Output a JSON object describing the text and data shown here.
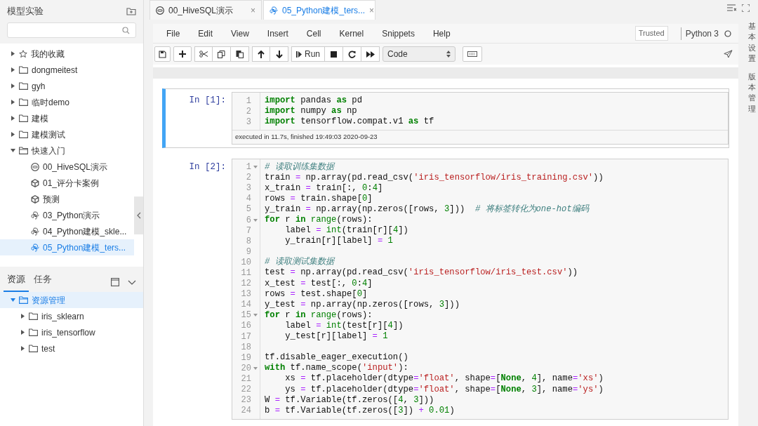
{
  "sidebar": {
    "title": "模型实验",
    "items": [
      {
        "label": "我的收藏",
        "kind": "star",
        "expanded": false,
        "selected": false
      },
      {
        "label": "dongmeitest",
        "kind": "folder",
        "expanded": false,
        "selected": false
      },
      {
        "label": "gyh",
        "kind": "folder",
        "expanded": false,
        "selected": false
      },
      {
        "label": "临时demo",
        "kind": "folder",
        "expanded": false,
        "selected": false
      },
      {
        "label": "建模",
        "kind": "folder",
        "expanded": false,
        "selected": false
      },
      {
        "label": "建模测试",
        "kind": "folder",
        "expanded": false,
        "selected": false
      },
      {
        "label": "快速入门",
        "kind": "folder",
        "expanded": true,
        "selected": false,
        "children": [
          {
            "label": "00_HiveSQL演示",
            "kind": "sql",
            "selected": false
          },
          {
            "label": "01_评分卡案例",
            "kind": "cube",
            "selected": false
          },
          {
            "label": "预测",
            "kind": "cube",
            "selected": false
          },
          {
            "label": "03_Python演示",
            "kind": "python",
            "selected": false
          },
          {
            "label": "04_Python建模_skle...",
            "kind": "python",
            "selected": false
          },
          {
            "label": "05_Python建模_ters...",
            "kind": "python",
            "selected": true
          }
        ]
      }
    ],
    "panel_tabs": [
      {
        "label": "资源",
        "selected": true
      },
      {
        "label": "任务",
        "selected": false
      }
    ],
    "resources": [
      {
        "label": "资源管理",
        "kind": "folder",
        "expanded": true,
        "selected": true,
        "children": [
          {
            "label": "iris_sklearn",
            "kind": "folder",
            "expanded": false,
            "selected": false
          },
          {
            "label": "iris_tensorflow",
            "kind": "folder",
            "expanded": false,
            "selected": false
          },
          {
            "label": "test",
            "kind": "folder",
            "expanded": false,
            "selected": false
          }
        ]
      }
    ]
  },
  "tabs": [
    {
      "label": "00_HiveSQL演示",
      "kind": "sql",
      "selected": false,
      "close": "×"
    },
    {
      "label": "05_Python建模_ters...",
      "kind": "python",
      "selected": true,
      "close": "×"
    }
  ],
  "menu": [
    "File",
    "Edit",
    "View",
    "Insert",
    "Cell",
    "Kernel",
    "Snippets",
    "Help"
  ],
  "trusted": "Trusted",
  "kernel": "Python 3",
  "toolbar": {
    "run": "Run",
    "cell_type": "Code"
  },
  "side_labels": [
    "基本设置",
    "版本管理"
  ],
  "cells": [
    {
      "prompt": "In [1]:",
      "selected": true,
      "info": "executed in 11.7s, finished 19:49:03 2020-09-23",
      "lines": [
        {
          "number": "1",
          "foldable": false,
          "tokens": [
            {
              "text": "import",
              "kind": "kw"
            },
            {
              "text": " pandas ",
              "kind": "plain"
            },
            {
              "text": "as",
              "kind": "kw"
            },
            {
              "text": " pd",
              "kind": "plain"
            }
          ]
        },
        {
          "number": "2",
          "foldable": false,
          "tokens": [
            {
              "text": "import",
              "kind": "kw"
            },
            {
              "text": " numpy ",
              "kind": "plain"
            },
            {
              "text": "as",
              "kind": "kw"
            },
            {
              "text": " np",
              "kind": "plain"
            }
          ]
        },
        {
          "number": "3",
          "foldable": false,
          "tokens": [
            {
              "text": "import",
              "kind": "kw"
            },
            {
              "text": " tensorflow.compat.v1 ",
              "kind": "plain"
            },
            {
              "text": "as",
              "kind": "kw"
            },
            {
              "text": " tf",
              "kind": "plain"
            }
          ]
        }
      ]
    },
    {
      "prompt": "In [2]:",
      "selected": false,
      "lines": [
        {
          "number": "1",
          "foldable": true,
          "tokens": [
            {
              "text": "# 读取训练集数据",
              "kind": "comment"
            }
          ]
        },
        {
          "number": "2",
          "foldable": false,
          "tokens": [
            {
              "text": "train ",
              "kind": "plain"
            },
            {
              "text": "=",
              "kind": "op"
            },
            {
              "text": " np.array(pd.read_csv(",
              "kind": "plain"
            },
            {
              "text": "'iris_tensorflow/iris_training.csv'",
              "kind": "str"
            },
            {
              "text": "))",
              "kind": "plain"
            }
          ]
        },
        {
          "number": "3",
          "foldable": false,
          "tokens": [
            {
              "text": "x_train ",
              "kind": "plain"
            },
            {
              "text": "=",
              "kind": "op"
            },
            {
              "text": " train[:, ",
              "kind": "plain"
            },
            {
              "text": "0",
              "kind": "num"
            },
            {
              "text": ":",
              "kind": "plain"
            },
            {
              "text": "4",
              "kind": "num"
            },
            {
              "text": "]",
              "kind": "plain"
            }
          ]
        },
        {
          "number": "4",
          "foldable": false,
          "tokens": [
            {
              "text": "rows ",
              "kind": "plain"
            },
            {
              "text": "=",
              "kind": "op"
            },
            {
              "text": " train.shape[",
              "kind": "plain"
            },
            {
              "text": "0",
              "kind": "num"
            },
            {
              "text": "]",
              "kind": "plain"
            }
          ]
        },
        {
          "number": "5",
          "foldable": false,
          "tokens": [
            {
              "text": "y_train ",
              "kind": "plain"
            },
            {
              "text": "=",
              "kind": "op"
            },
            {
              "text": " np.array(np.zeros([rows, ",
              "kind": "plain"
            },
            {
              "text": "3",
              "kind": "num"
            },
            {
              "text": "]))  ",
              "kind": "plain"
            },
            {
              "text": "# 将标签转化为one-hot编码",
              "kind": "comment"
            }
          ]
        },
        {
          "number": "6",
          "foldable": true,
          "tokens": [
            {
              "text": "for",
              "kind": "kw"
            },
            {
              "text": " r ",
              "kind": "plain"
            },
            {
              "text": "in",
              "kind": "kw"
            },
            {
              "text": " range",
              "kind": "builtin"
            },
            {
              "text": "(rows):",
              "kind": "plain"
            }
          ]
        },
        {
          "number": "7",
          "foldable": false,
          "tokens": [
            {
              "text": "    label ",
              "kind": "plain"
            },
            {
              "text": "=",
              "kind": "op"
            },
            {
              "text": " int",
              "kind": "builtin"
            },
            {
              "text": "(train[r][",
              "kind": "plain"
            },
            {
              "text": "4",
              "kind": "num"
            },
            {
              "text": "])",
              "kind": "plain"
            }
          ]
        },
        {
          "number": "8",
          "foldable": false,
          "tokens": [
            {
              "text": "    y_train[r][label] ",
              "kind": "plain"
            },
            {
              "text": "=",
              "kind": "op"
            },
            {
              "text": " 1",
              "kind": "num"
            }
          ]
        },
        {
          "number": "9",
          "foldable": false
        },
        {
          "number": "10",
          "foldable": false,
          "tokens": [
            {
              "text": "# 读取测试集数据",
              "kind": "comment"
            }
          ]
        },
        {
          "number": "11",
          "foldable": false,
          "tokens": [
            {
              "text": "test ",
              "kind": "plain"
            },
            {
              "text": "=",
              "kind": "op"
            },
            {
              "text": " np.array(pd.read_csv(",
              "kind": "plain"
            },
            {
              "text": "'iris_tensorflow/iris_test.csv'",
              "kind": "str"
            },
            {
              "text": "))",
              "kind": "plain"
            }
          ]
        },
        {
          "number": "12",
          "foldable": false,
          "tokens": [
            {
              "text": "x_test ",
              "kind": "plain"
            },
            {
              "text": "=",
              "kind": "op"
            },
            {
              "text": " test[:, ",
              "kind": "plain"
            },
            {
              "text": "0",
              "kind": "num"
            },
            {
              "text": ":",
              "kind": "plain"
            },
            {
              "text": "4",
              "kind": "num"
            },
            {
              "text": "]",
              "kind": "plain"
            }
          ]
        },
        {
          "number": "13",
          "foldable": false,
          "tokens": [
            {
              "text": "rows ",
              "kind": "plain"
            },
            {
              "text": "=",
              "kind": "op"
            },
            {
              "text": " test.shape[",
              "kind": "plain"
            },
            {
              "text": "0",
              "kind": "num"
            },
            {
              "text": "]",
              "kind": "plain"
            }
          ]
        },
        {
          "number": "14",
          "foldable": false,
          "tokens": [
            {
              "text": "y_test ",
              "kind": "plain"
            },
            {
              "text": "=",
              "kind": "op"
            },
            {
              "text": " np.array(np.zeros([rows, ",
              "kind": "plain"
            },
            {
              "text": "3",
              "kind": "num"
            },
            {
              "text": "]))",
              "kind": "plain"
            }
          ]
        },
        {
          "number": "15",
          "foldable": true,
          "tokens": [
            {
              "text": "for",
              "kind": "kw"
            },
            {
              "text": " r ",
              "kind": "plain"
            },
            {
              "text": "in",
              "kind": "kw"
            },
            {
              "text": " range",
              "kind": "builtin"
            },
            {
              "text": "(rows):",
              "kind": "plain"
            }
          ]
        },
        {
          "number": "16",
          "foldable": false,
          "tokens": [
            {
              "text": "    label ",
              "kind": "plain"
            },
            {
              "text": "=",
              "kind": "op"
            },
            {
              "text": " int",
              "kind": "builtin"
            },
            {
              "text": "(test[r][",
              "kind": "plain"
            },
            {
              "text": "4",
              "kind": "num"
            },
            {
              "text": "])",
              "kind": "plain"
            }
          ]
        },
        {
          "number": "17",
          "foldable": false,
          "tokens": [
            {
              "text": "    y_test[r][label] ",
              "kind": "plain"
            },
            {
              "text": "=",
              "kind": "op"
            },
            {
              "text": " 1",
              "kind": "num"
            }
          ]
        },
        {
          "number": "18",
          "foldable": false
        },
        {
          "number": "19",
          "foldable": false,
          "tokens": [
            {
              "text": "tf.disable_eager_execution()",
              "kind": "plain"
            }
          ]
        },
        {
          "number": "20",
          "foldable": true,
          "tokens": [
            {
              "text": "with",
              "kind": "kw"
            },
            {
              "text": " tf.name_scope(",
              "kind": "plain"
            },
            {
              "text": "'input'",
              "kind": "str"
            },
            {
              "text": "):",
              "kind": "plain"
            }
          ]
        },
        {
          "number": "21",
          "foldable": false,
          "tokens": [
            {
              "text": "    xs ",
              "kind": "plain"
            },
            {
              "text": "=",
              "kind": "op"
            },
            {
              "text": " tf.placeholder(dtype",
              "kind": "plain"
            },
            {
              "text": "=",
              "kind": "op"
            },
            {
              "text": "'float'",
              "kind": "str"
            },
            {
              "text": ", shape",
              "kind": "plain"
            },
            {
              "text": "=",
              "kind": "op"
            },
            {
              "text": "[",
              "kind": "plain"
            },
            {
              "text": "None",
              "kind": "kw"
            },
            {
              "text": ", ",
              "kind": "plain"
            },
            {
              "text": "4",
              "kind": "num"
            },
            {
              "text": "], name",
              "kind": "plain"
            },
            {
              "text": "=",
              "kind": "op"
            },
            {
              "text": "'xs'",
              "kind": "str"
            },
            {
              "text": ")",
              "kind": "plain"
            }
          ]
        },
        {
          "number": "22",
          "foldable": false,
          "tokens": [
            {
              "text": "    ys ",
              "kind": "plain"
            },
            {
              "text": "=",
              "kind": "op"
            },
            {
              "text": " tf.placeholder(dtype",
              "kind": "plain"
            },
            {
              "text": "=",
              "kind": "op"
            },
            {
              "text": "'float'",
              "kind": "str"
            },
            {
              "text": ", shape",
              "kind": "plain"
            },
            {
              "text": "=",
              "kind": "op"
            },
            {
              "text": "[",
              "kind": "plain"
            },
            {
              "text": "None",
              "kind": "kw"
            },
            {
              "text": ", ",
              "kind": "plain"
            },
            {
              "text": "3",
              "kind": "num"
            },
            {
              "text": "], name",
              "kind": "plain"
            },
            {
              "text": "=",
              "kind": "op"
            },
            {
              "text": "'ys'",
              "kind": "str"
            },
            {
              "text": ")",
              "kind": "plain"
            }
          ]
        },
        {
          "number": "23",
          "foldable": false,
          "tokens": [
            {
              "text": "W ",
              "kind": "plain"
            },
            {
              "text": "=",
              "kind": "op"
            },
            {
              "text": " tf.Variable(tf.zeros([",
              "kind": "plain"
            },
            {
              "text": "4",
              "kind": "num"
            },
            {
              "text": ", ",
              "kind": "plain"
            },
            {
              "text": "3",
              "kind": "num"
            },
            {
              "text": "]))",
              "kind": "plain"
            }
          ]
        },
        {
          "number": "24",
          "foldable": false,
          "tokens": [
            {
              "text": "b ",
              "kind": "plain"
            },
            {
              "text": "=",
              "kind": "op"
            },
            {
              "text": " tf.Variable(tf.zeros([",
              "kind": "plain"
            },
            {
              "text": "3",
              "kind": "num"
            },
            {
              "text": "]) ",
              "kind": "plain"
            },
            {
              "text": "+",
              "kind": "op"
            },
            {
              "text": " 0.01",
              "kind": "num"
            },
            {
              "text": ")",
              "kind": "plain"
            }
          ]
        }
      ]
    }
  ]
}
